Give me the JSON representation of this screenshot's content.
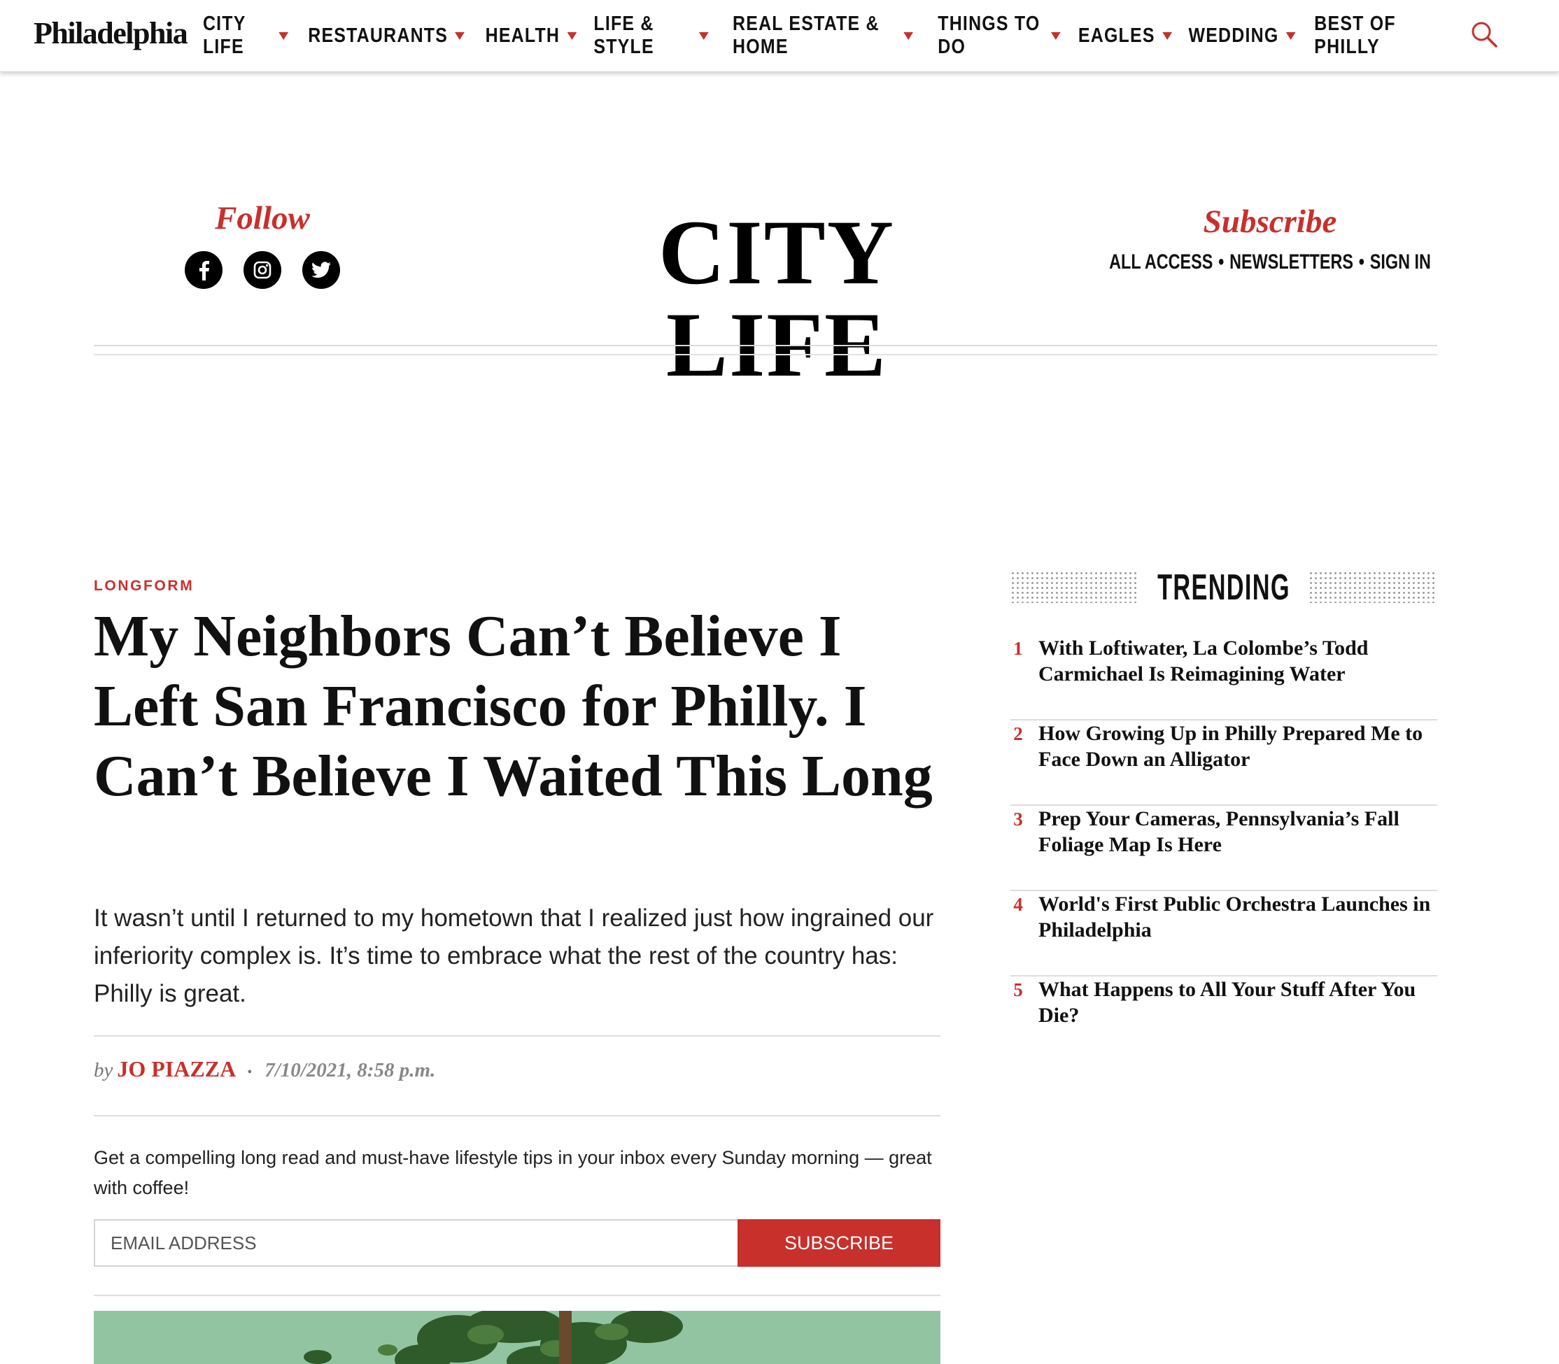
{
  "nav": {
    "logo": "Philadelphia",
    "items": [
      {
        "label": "CITY LIFE",
        "dropdown": true
      },
      {
        "label": "RESTAURANTS",
        "dropdown": true
      },
      {
        "label": "HEALTH",
        "dropdown": true
      },
      {
        "label": "LIFE & STYLE",
        "dropdown": true
      },
      {
        "label": "REAL ESTATE & HOME",
        "dropdown": true
      },
      {
        "label": "THINGS TO DO",
        "dropdown": true
      },
      {
        "label": "EAGLES",
        "dropdown": true
      },
      {
        "label": "WEDDING",
        "dropdown": true
      },
      {
        "label": "BEST OF PHILLY",
        "dropdown": false
      }
    ],
    "search_icon": "search-icon"
  },
  "section_header": {
    "follow_label": "Follow",
    "social_icons": [
      "facebook-icon",
      "instagram-icon",
      "twitter-icon"
    ],
    "title": "CITY LIFE",
    "subscribe_label": "Subscribe",
    "links": [
      "ALL ACCESS",
      "NEWSLETTERS",
      "SIGN IN"
    ],
    "separator": "•"
  },
  "article": {
    "kicker": "LONGFORM",
    "headline": "My Neighbors Can’t Believe I Left San Francisco for Philly. I Can’t Believe I Waited This Long",
    "dek": "It wasn’t until I returned to my hometown that I realized just how ingrained our inferiority complex is. It’s time to embrace what the rest of the country has: Philly is great.",
    "by": "by",
    "author": "JO PIAZZA",
    "date": "7/10/2021, 8:58 p.m.",
    "dot": "•"
  },
  "newsletter": {
    "promo": "Get a compelling long read and must-have lifestyle tips in your inbox every Sunday morning — great with coffee!",
    "email_placeholder": "EMAIL ADDRESS",
    "email_value": "",
    "button_label": "SUBSCRIBE"
  },
  "trending": {
    "title": "TRENDING",
    "items": [
      {
        "num": "1",
        "title": "With Loftiwater, La Colombe’s Todd Carmichael Is Reimagining Water"
      },
      {
        "num": "2",
        "title": "How Growing Up in Philly Prepared Me to Face Down an Alligator"
      },
      {
        "num": "3",
        "title": "Prep Your Cameras, Pennsylvania’s Fall Foliage Map Is Here"
      },
      {
        "num": "4",
        "title": "World's First Public Orchestra Launches in Philadelphia"
      },
      {
        "num": "5",
        "title": "What Happens to All Your Stuff After You Die?"
      }
    ]
  },
  "colors": {
    "accent": "#c8302c",
    "text": "#111111",
    "rule": "#dedede",
    "hero_bg": "#93c4a1",
    "tree_green": "#2f5a2a"
  }
}
